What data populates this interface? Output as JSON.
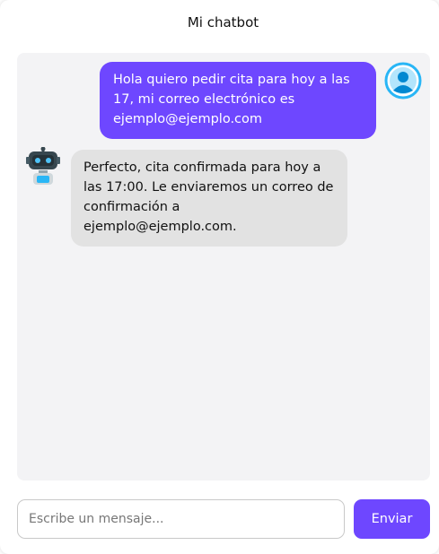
{
  "header": {
    "title": "Mi chatbot"
  },
  "messages": [
    {
      "sender": "user",
      "lines": [
        "Hola quiero pedir cita para hoy a las",
        "17, mi correo electrónico es",
        "ejemplo@ejemplo.com"
      ],
      "avatar_icon": "user-avatar-icon"
    },
    {
      "sender": "bot",
      "lines": [
        "Perfecto, cita confirmada para hoy a",
        "las 17:00. Le enviaremos un correo de",
        "confirmación a",
        "ejemplo@ejemplo.com."
      ],
      "avatar_icon": "robot-avatar-icon"
    }
  ],
  "composer": {
    "input_placeholder": "Escribe un mensaje...",
    "input_value": "",
    "send_label": "Enviar"
  },
  "colors": {
    "accent": "#6e47ff",
    "chat_background": "#f3f3f5",
    "bot_bubble": "#e2e2e2",
    "user_avatar": "#29b6f6"
  }
}
